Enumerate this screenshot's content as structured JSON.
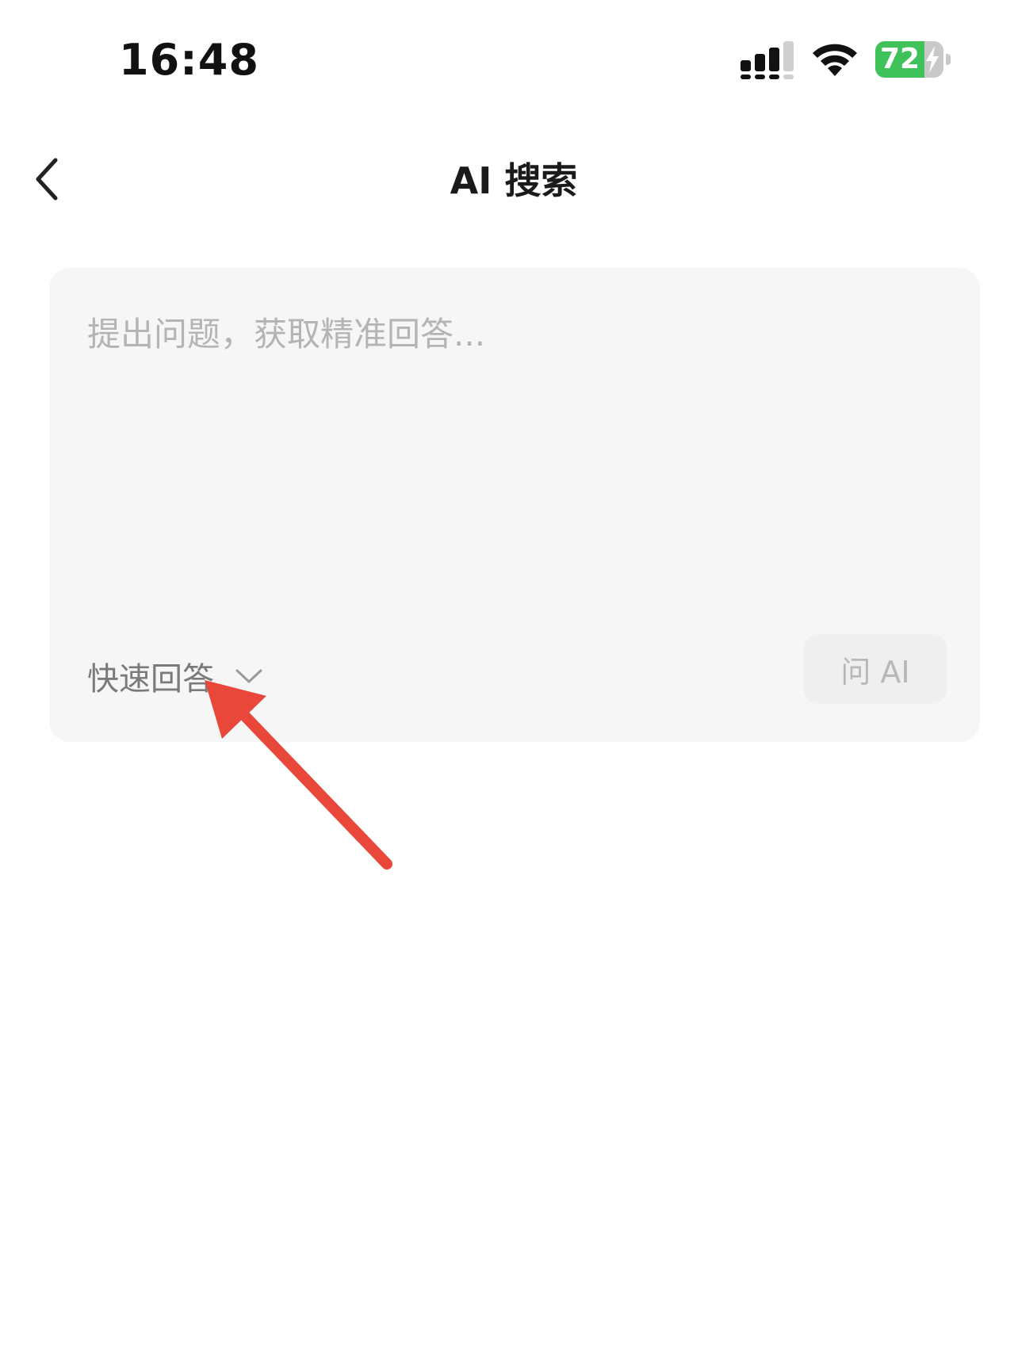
{
  "status_bar": {
    "time": "16:48",
    "battery_level": "72",
    "battery_fraction": 0.72,
    "battery_color": "#3fc25a",
    "icons": [
      "cellular-signal-icon",
      "wifi-icon",
      "battery-charging-icon"
    ]
  },
  "nav": {
    "back_icon": "chevron-left-icon",
    "title": "AI 搜索"
  },
  "query": {
    "placeholder": "提出问题，获取精准回答...",
    "value": ""
  },
  "mode": {
    "selected": "快速回答",
    "icon": "chevron-down-icon"
  },
  "actions": {
    "ask_label": "问 AI"
  },
  "annotation": {
    "arrow_color": "#e8473a",
    "icon": "pointer-arrow-icon"
  }
}
